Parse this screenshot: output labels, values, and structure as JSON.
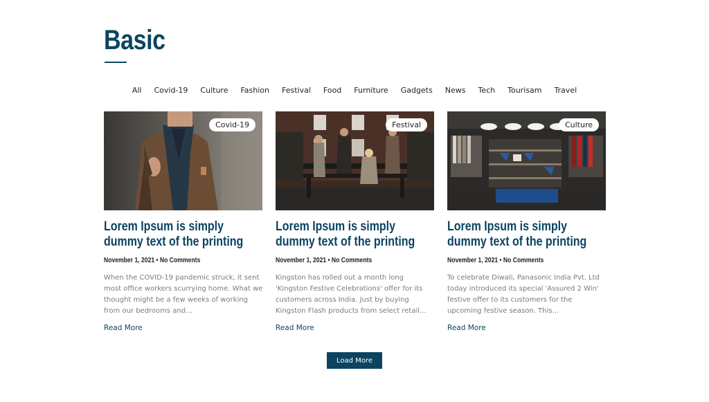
{
  "page": {
    "title": "Basic"
  },
  "filters": [
    "All",
    "Covid-19",
    "Culture",
    "Fashion",
    "Festival",
    "Food",
    "Furniture",
    "Gadgets",
    "News",
    "Tech",
    "Tourisam",
    "Travel"
  ],
  "cards": [
    {
      "badge": "Covid-19",
      "title": "Lorem Ipsum is simply dummy text of the printing",
      "meta": "November 1, 2021 • No Comments",
      "excerpt": "When the COVID-19 pandemic struck, it sent most office workers scurrying home. What we thought might be a few weeks of working from our bedrooms and...",
      "read_more": "Read More",
      "image": "man-in-tweed-jacket-with-backpack"
    },
    {
      "badge": "Festival",
      "title": "Lorem Ipsum is simply dummy text of the printing",
      "meta": "November 1, 2021 • No Comments",
      "excerpt": "Kingston has rolled out a month long 'Kingston Festive Celebrations' offer for its customers across India. Just by buying Kingston Flash products from select retail...",
      "read_more": "Read More",
      "image": "group-on-bench-in-front-of-brick-building"
    },
    {
      "badge": "Culture",
      "title": "Lorem Ipsum is simply dummy text of the printing",
      "meta": "November 1, 2021 • No Comments",
      "excerpt": "To celebrate Diwali, Panasonic India Pvt. Ltd today introduced its special 'Assured 2 Win' festive offer to its customers for the upcoming festive season. This...",
      "read_more": "Read More",
      "image": "clothing-store-interior"
    }
  ],
  "load_more": "Load More",
  "colors": {
    "accent": "#0b4461",
    "excerpt": "#7a7a7a"
  }
}
